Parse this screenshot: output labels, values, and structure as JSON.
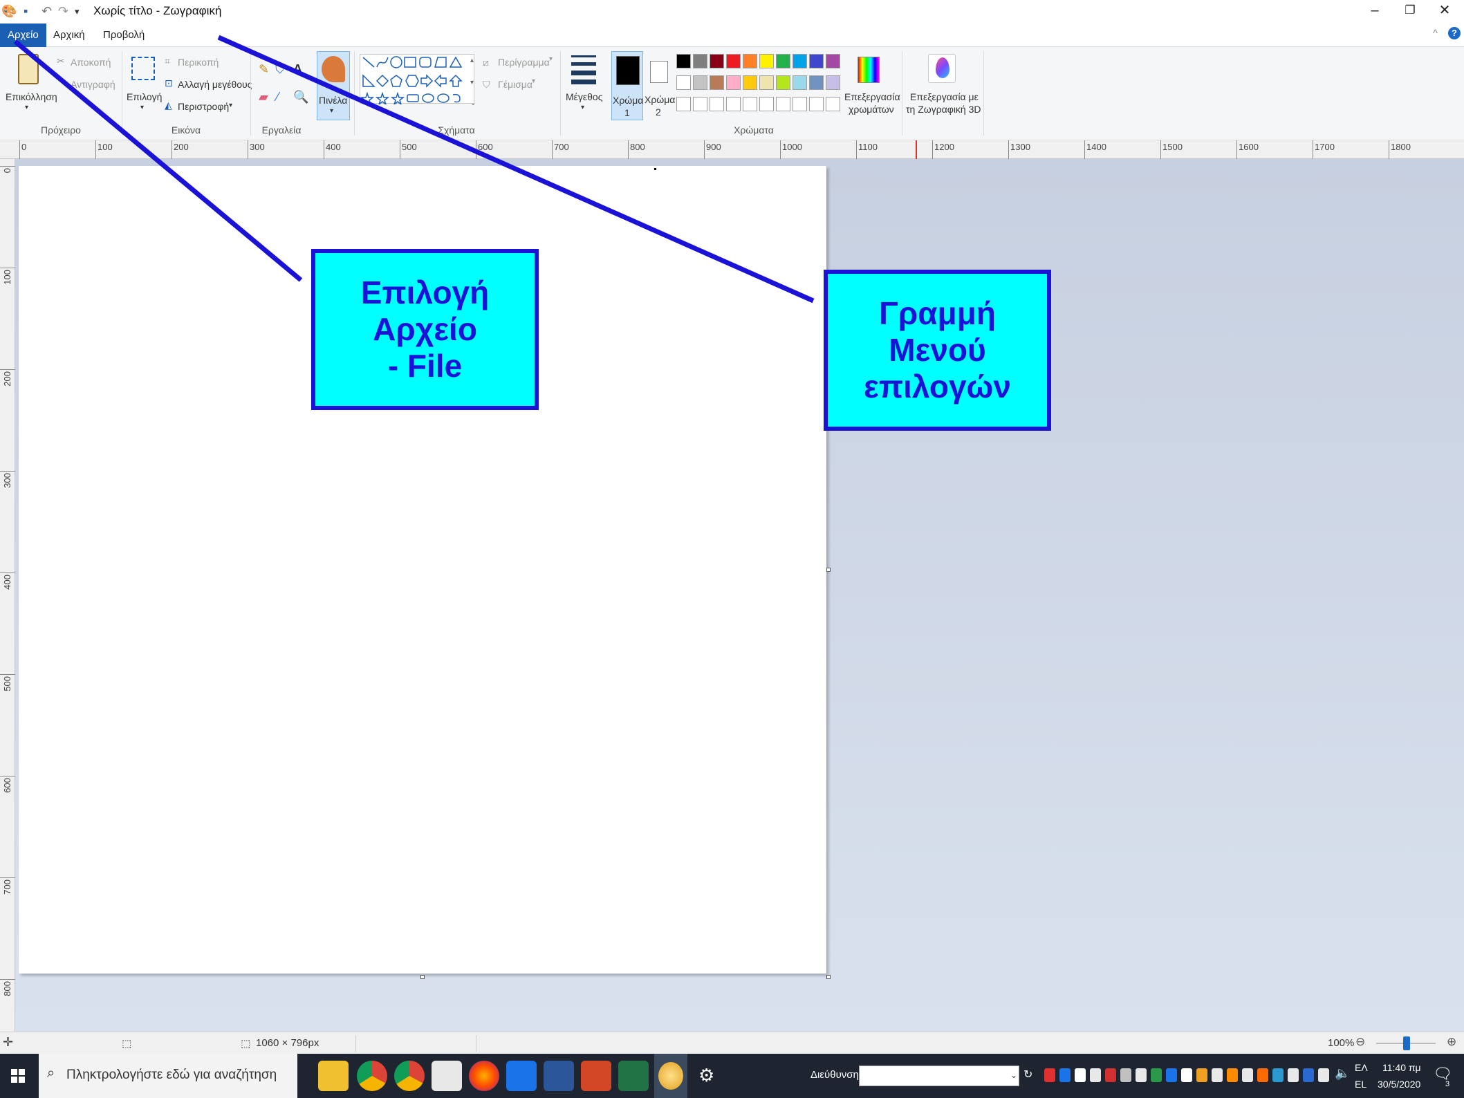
{
  "window": {
    "title": "Χωρίς τίτλο - Ζωγραφική"
  },
  "menu": {
    "tabs": [
      "Αρχείο",
      "Αρχική",
      "Προβολή"
    ]
  },
  "ribbon": {
    "clipboard": {
      "paste": "Επικόλληση",
      "cut": "Αποκοπή",
      "copy": "Αντιγραφή",
      "group": "Πρόχειρο"
    },
    "image": {
      "select": "Επιλογή",
      "crop": "Περικοπή",
      "resize": "Αλλαγή μεγέθους",
      "rotate": "Περιστροφή",
      "group": "Εικόνα"
    },
    "tools": {
      "group": "Εργαλεία"
    },
    "brushes": {
      "label": "Πινέλα"
    },
    "shapes": {
      "outline": "Περίγραμμα",
      "fill": "Γέμισμα",
      "group": "Σχήματα"
    },
    "size": {
      "label": "Μέγεθος"
    },
    "colors": {
      "color1": "Χρώμα",
      "color1_num": "1",
      "color2": "Χρώμα",
      "color2_num": "2",
      "edit_colors_1": "Επεξεργασία",
      "edit_colors_2": "χρωμάτων",
      "group": "Χρώματα",
      "palette_row1": [
        "#000000",
        "#7f7f7f",
        "#880015",
        "#ed1c24",
        "#ff7f27",
        "#fff200",
        "#22b14c",
        "#00a2e8",
        "#3f48cc",
        "#a349a4"
      ],
      "palette_row2": [
        "#ffffff",
        "#c3c3c3",
        "#b97a57",
        "#ffaec9",
        "#ffc90e",
        "#efe4b0",
        "#b5e61d",
        "#99d9ea",
        "#7092be",
        "#c8bfe7"
      ]
    },
    "paint3d": {
      "line1": "Επεξεργασία με",
      "line2": "τη Ζωγραφική 3D"
    }
  },
  "ruler": {
    "h": [
      "0",
      "100",
      "200",
      "300",
      "400",
      "500",
      "600",
      "700",
      "800",
      "900",
      "1000",
      "1100",
      "1200",
      "1300",
      "1400",
      "1500",
      "1600",
      "1700",
      "1800"
    ],
    "v": [
      "0",
      "100",
      "200",
      "300",
      "400",
      "500",
      "600",
      "700",
      "800"
    ]
  },
  "callouts": {
    "file": [
      "Επιλογή",
      "Αρχείο",
      "- File"
    ],
    "menu": [
      "Γραμμή",
      "Μενού",
      "επιλογών"
    ]
  },
  "status": {
    "dimensions": "1060 × 796px",
    "zoom": "100%"
  },
  "taskbar": {
    "search_placeholder": "Πληκτρολογήστε εδώ για αναζήτηση",
    "address_label": "Διεύθυνση",
    "lang_top": "ΕΛ",
    "lang_bottom": "EL",
    "time": "11:40 πμ",
    "date": "30/5/2020",
    "notif_count": "3"
  }
}
